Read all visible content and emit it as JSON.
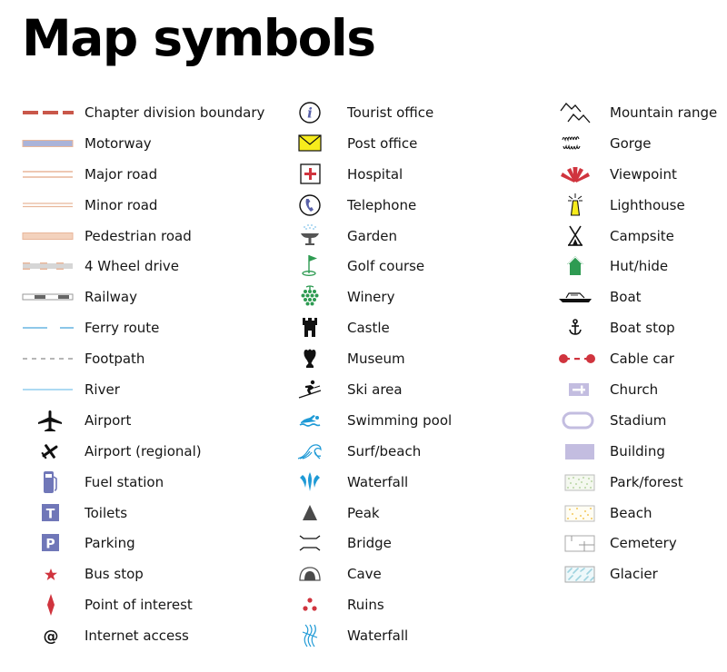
{
  "title": "Map symbols",
  "columns": [
    {
      "items": [
        {
          "label": "Chapter division boundary",
          "icon": "dashed-line-red"
        },
        {
          "label": "Motorway",
          "icon": "line-blue-orange"
        },
        {
          "label": "Major road",
          "icon": "line-double-orange"
        },
        {
          "label": "Minor road",
          "icon": "line-thin-orange"
        },
        {
          "label": "Pedestrian road",
          "icon": "line-filled-orange"
        },
        {
          "label": "4 Wheel drive",
          "icon": "line-dashed-grey-orange"
        },
        {
          "label": "Railway",
          "icon": "line-railway"
        },
        {
          "label": "Ferry route",
          "icon": "line-dashed-blue"
        },
        {
          "label": "Footpath",
          "icon": "line-dashed-grey"
        },
        {
          "label": "River",
          "icon": "line-light-blue"
        },
        {
          "label": "Airport",
          "icon": "airplane-icon"
        },
        {
          "label": "Airport (regional)",
          "icon": "small-airplane-icon"
        },
        {
          "label": "Fuel station",
          "icon": "fuel-pump-icon"
        },
        {
          "label": "Toilets",
          "icon": "toilets-icon"
        },
        {
          "label": "Parking",
          "icon": "parking-icon"
        },
        {
          "label": "Bus stop",
          "icon": "star-icon"
        },
        {
          "label": "Point of interest",
          "icon": "diamond-icon"
        },
        {
          "label": "Internet access",
          "icon": "at-sign-icon"
        }
      ]
    },
    {
      "items": [
        {
          "label": "Tourist office",
          "icon": "info-icon"
        },
        {
          "label": "Post office",
          "icon": "envelope-icon"
        },
        {
          "label": "Hospital",
          "icon": "hospital-cross-icon"
        },
        {
          "label": "Telephone",
          "icon": "telephone-icon"
        },
        {
          "label": "Garden",
          "icon": "fountain-icon"
        },
        {
          "label": "Golf course",
          "icon": "golf-flag-icon"
        },
        {
          "label": "Winery",
          "icon": "grapes-icon"
        },
        {
          "label": "Castle",
          "icon": "castle-icon"
        },
        {
          "label": "Museum",
          "icon": "museum-urn-icon"
        },
        {
          "label": "Ski area",
          "icon": "skier-icon"
        },
        {
          "label": "Swimming pool",
          "icon": "swimmer-icon"
        },
        {
          "label": "Surf/beach",
          "icon": "wave-icon"
        },
        {
          "label": "Waterfall",
          "icon": "waterfall-spray-icon"
        },
        {
          "label": "Peak",
          "icon": "peak-triangle-icon"
        },
        {
          "label": "Bridge",
          "icon": "bridge-icon"
        },
        {
          "label": "Cave",
          "icon": "cave-icon"
        },
        {
          "label": "Ruins",
          "icon": "ruins-dots-icon"
        },
        {
          "label": "Waterfall",
          "icon": "waterfall-lines-icon"
        }
      ]
    },
    {
      "items": [
        {
          "label": "Mountain range",
          "icon": "mountain-range-icon"
        },
        {
          "label": "Gorge",
          "icon": "gorge-icon"
        },
        {
          "label": "Viewpoint",
          "icon": "viewpoint-icon"
        },
        {
          "label": "Lighthouse",
          "icon": "lighthouse-icon"
        },
        {
          "label": "Campsite",
          "icon": "tent-icon"
        },
        {
          "label": "Hut/hide",
          "icon": "hut-icon"
        },
        {
          "label": "Boat",
          "icon": "boat-icon"
        },
        {
          "label": "Boat stop",
          "icon": "anchor-icon"
        },
        {
          "label": "Cable car",
          "icon": "cable-car-icon"
        },
        {
          "label": "Church",
          "icon": "church-icon"
        },
        {
          "label": "Stadium",
          "icon": "stadium-icon"
        },
        {
          "label": "Building",
          "icon": "building-icon"
        },
        {
          "label": "Park/forest",
          "icon": "park-area-icon"
        },
        {
          "label": "Beach",
          "icon": "beach-area-icon"
        },
        {
          "label": "Cemetery",
          "icon": "cemetery-area-icon"
        },
        {
          "label": "Glacier",
          "icon": "glacier-area-icon"
        }
      ]
    }
  ],
  "colors": {
    "boundary_red": "#c9574a",
    "motorway_blue": "#aab3d9",
    "road_orange": "#e8b69a",
    "ferry_blue": "#4aa8dc",
    "river_blue": "#7cc4ec",
    "footpath_grey": "#8a8a8a",
    "service_blue": "#7077b8",
    "poi_red": "#d0343e",
    "post_yellow": "#f7ec1c",
    "golf_green": "#2e9b52",
    "water_blue": "#1f9ad6",
    "peak_grey": "#4a4a4a",
    "church_lilac": "#c3bde0"
  }
}
